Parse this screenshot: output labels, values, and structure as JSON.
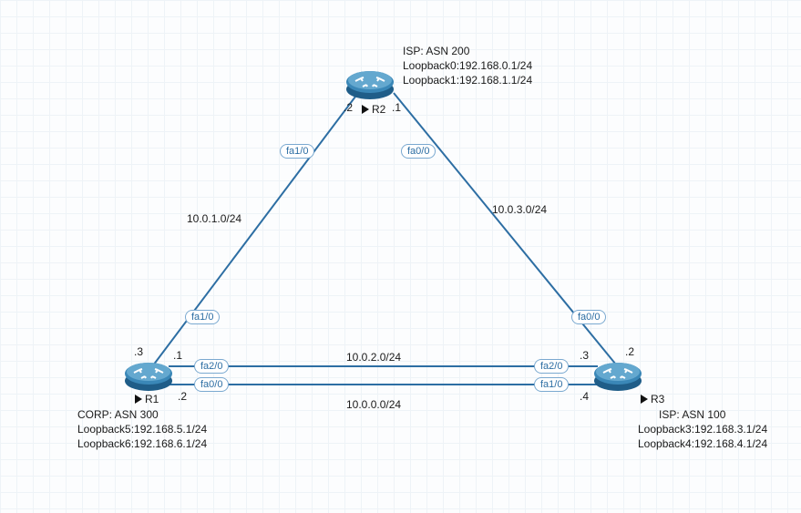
{
  "routers": {
    "r1": {
      "name": "R1",
      "asn_label": "CORP: ASN 300",
      "loopbacks": [
        "Loopback5:192.168.5.1/24",
        "Loopback6:192.168.6.1/24"
      ]
    },
    "r2": {
      "name": "R2",
      "asn_label": "ISP: ASN 200",
      "loopbacks": [
        "Loopback0:192.168.0.1/24",
        "Loopback1:192.168.1.1/24"
      ]
    },
    "r3": {
      "name": "R3",
      "asn_label": "ISP: ASN 100",
      "loopbacks": [
        "Loopback3:192.168.3.1/24",
        "Loopback4:192.168.4.1/24"
      ]
    }
  },
  "interfaces": {
    "r1_fa10": "fa1/0",
    "r1_fa20": "fa2/0",
    "r1_fa00": "fa0/0",
    "r2_fa10": "fa1/0",
    "r2_fa00": "fa0/0",
    "r3_fa00": "fa0/0",
    "r3_fa20": "fa2/0",
    "r3_fa10": "fa1/0"
  },
  "subnets": {
    "r1r2": "10.0.1.0/24",
    "r2r3": "10.0.3.0/24",
    "r1r3_upper": "10.0.2.0/24",
    "r1r3_lower": "10.0.0.0/24"
  },
  "host_octets": {
    "r1_to_r2": ".3",
    "r1_to_r3_up": ".1",
    "r1_to_r3_low": ".2",
    "r2_left": ".2",
    "r2_right": ".1",
    "r3_to_r2": ".2",
    "r3_to_r1_up": ".3",
    "r3_to_r1_low": ".4"
  },
  "chart_data": {
    "type": "network-topology",
    "nodes": [
      {
        "id": "R1",
        "asn": 300,
        "role": "CORP",
        "loopbacks": {
          "Loopback5": "192.168.5.1/24",
          "Loopback6": "192.168.6.1/24"
        }
      },
      {
        "id": "R2",
        "asn": 200,
        "role": "ISP",
        "loopbacks": {
          "Loopback0": "192.168.0.1/24",
          "Loopback1": "192.168.1.1/24"
        }
      },
      {
        "id": "R3",
        "asn": 100,
        "role": "ISP",
        "loopbacks": {
          "Loopback3": "192.168.3.1/24",
          "Loopback4": "192.168.4.1/24"
        }
      }
    ],
    "links": [
      {
        "from": "R1",
        "from_if": "fa1/0",
        "from_ip": "10.0.1.3",
        "to": "R2",
        "to_if": "fa1/0",
        "to_ip": "10.0.1.2",
        "subnet": "10.0.1.0/24"
      },
      {
        "from": "R2",
        "from_if": "fa0/0",
        "from_ip": "10.0.3.1",
        "to": "R3",
        "to_if": "fa0/0",
        "to_ip": "10.0.3.2",
        "subnet": "10.0.3.0/24"
      },
      {
        "from": "R1",
        "from_if": "fa2/0",
        "from_ip": "10.0.2.1",
        "to": "R3",
        "to_if": "fa2/0",
        "to_ip": "10.0.2.3",
        "subnet": "10.0.2.0/24"
      },
      {
        "from": "R1",
        "from_if": "fa0/0",
        "from_ip": "10.0.0.2",
        "to": "R3",
        "to_if": "fa1/0",
        "to_ip": "10.0.0.4",
        "subnet": "10.0.0.0/24"
      }
    ]
  }
}
